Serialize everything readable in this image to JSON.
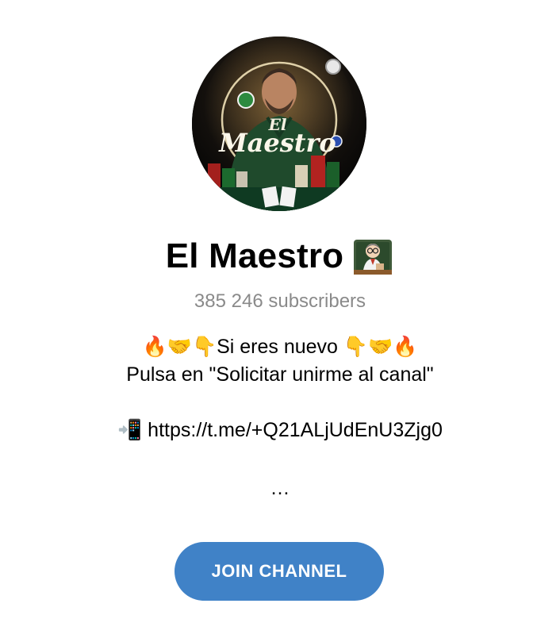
{
  "channel": {
    "name": "El Maestro",
    "name_emoji": "teacher-emoji",
    "subscribers": "385 246 subscribers",
    "avatar_text_top": "El",
    "avatar_text_main": "Maestro",
    "description_lines": [
      "🔥🤝👇Si eres nuevo  👇🤝🔥",
      "Pulsa en \"Solicitar unirme al canal\"",
      "",
      "📲 https://t.me/+Q21ALjUdEnU3Zjg0"
    ],
    "description_more": "…"
  },
  "join_button": {
    "label": "JOIN CHANNEL"
  },
  "colors": {
    "accent": "#4082c7",
    "subtle_text": "#8a8a8a",
    "background": "#ffffff"
  }
}
